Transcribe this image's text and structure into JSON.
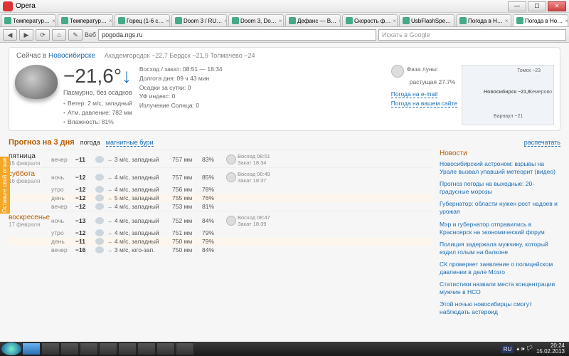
{
  "titlebar": {
    "app": "Opera"
  },
  "tabs": [
    {
      "label": "Температур…"
    },
    {
      "label": "Температур…"
    },
    {
      "label": "Горец (1-6 с…"
    },
    {
      "label": "Doom 3 / RU…"
    },
    {
      "label": "Doom 3, Do…"
    },
    {
      "label": "Дефанс — B…"
    },
    {
      "label": "Скорость ф…"
    },
    {
      "label": "UsbFlashSpe…"
    },
    {
      "label": "Погода в Н…"
    },
    {
      "label": "Погода в Но…"
    }
  ],
  "addr": {
    "label": "Веб",
    "url": "pogoda.ngs.ru",
    "search_ph": "Искать в Google"
  },
  "now": {
    "prefix": "Сейчас в ",
    "city": "Новосибирске",
    "stations": "Академгородок −22,7   Бердск −21,9   Толмачево −24",
    "temp": "−21,6°",
    "arrow": "↓",
    "cond": "Пасмурно, без осадков",
    "wind": "Ветер: 2 м/с, западный",
    "press": "Атм. давление: 782 мм",
    "hum": "Влажность: 81%",
    "sun": "Восход / закат: 08:51 — 18:34",
    "daylen": "Долгота дня: 09 ч 43 мин",
    "precip": "Осадки за сутки: 0",
    "uv": "УФ индекс: 0",
    "solar": "Излучение Солнца: 0",
    "moon_l": "Фаза луны:",
    "moon_v": "растущая 27.7%",
    "l_email": "Погода на e-mail",
    "l_site": "Погода на вашем сайте",
    "map": {
      "tomsk": "Томск −23",
      "nsk": "Новосибирск −21,6",
      "kem": "Кемерово",
      "barn": "Барнаул −21"
    }
  },
  "fc": {
    "title": "Прогноз на 3 дня",
    "t1": "погода",
    "t2": "магнитные бури",
    "print": "распечатать",
    "days": [
      {
        "name": "пятница",
        "cls": "fri",
        "date": "15 февраля",
        "rows": [
          {
            "p": "вечер",
            "t": "−11",
            "w": "3 м/с, западный",
            "pr": "757 мм",
            "h": "83%"
          }
        ],
        "sun": {
          "r": "Восход 08:51",
          "s": "Закат 18:34"
        }
      },
      {
        "name": "суббота",
        "cls": "sat",
        "date": "16 февраля",
        "rows": [
          {
            "p": "ночь",
            "t": "−12",
            "w": "4 м/с, западный",
            "pr": "757 мм",
            "h": "85%"
          },
          {
            "p": "утро",
            "t": "−12",
            "w": "4 м/с, западный",
            "pr": "756 мм",
            "h": "78%"
          },
          {
            "p": "день",
            "t": "−12",
            "w": "5 м/с, западный",
            "pr": "755 мм",
            "h": "76%",
            "hi": true
          },
          {
            "p": "вечер",
            "t": "−12",
            "w": "4 м/с, западный",
            "pr": "753 мм",
            "h": "81%"
          }
        ],
        "sun": {
          "r": "Восход 08:49",
          "s": "Закат 18:37"
        }
      },
      {
        "name": "воскресенье",
        "cls": "sun",
        "date": "17 февраля",
        "rows": [
          {
            "p": "ночь",
            "t": "−13",
            "w": "4 м/с, западный",
            "pr": "752 мм",
            "h": "84%"
          },
          {
            "p": "утро",
            "t": "−12",
            "w": "4 м/с, западный",
            "pr": "751 мм",
            "h": "79%"
          },
          {
            "p": "день",
            "t": "−11",
            "w": "4 м/с, западный",
            "pr": "750 мм",
            "h": "79%",
            "hi": true
          },
          {
            "p": "вечер",
            "t": "−16",
            "w": "3 м/с, юго-зап.",
            "pr": "750 мм",
            "h": "84%"
          }
        ],
        "sun": {
          "r": "Восход 08:47",
          "s": "Закат 18:39"
        }
      }
    ]
  },
  "news": {
    "title": "Новости",
    "items": [
      "Новосибирский астроном: взрывы на Урале вызвал упавший метеорит (видео)",
      "Прогноз погоды на выходные: 20-градусные морозы",
      "Губернатор: области нужен рост надоев и урожая",
      "Мэр и губернатор отправились в Красноярск на экономический форум",
      "Полиция задержала мужчину, который ездил голым на балконе",
      "СК проверяет заявление о полицейском давлении в деле Мозго",
      "Статистики назвали места концентрации мужчин в НСО",
      "Этой ночью новосибирцы смогут наблюдать астероид"
    ]
  },
  "feedback": "Оставьте свой отзыв",
  "task": {
    "lang": "RU",
    "time": "20:24",
    "date": "15.02.2013"
  }
}
